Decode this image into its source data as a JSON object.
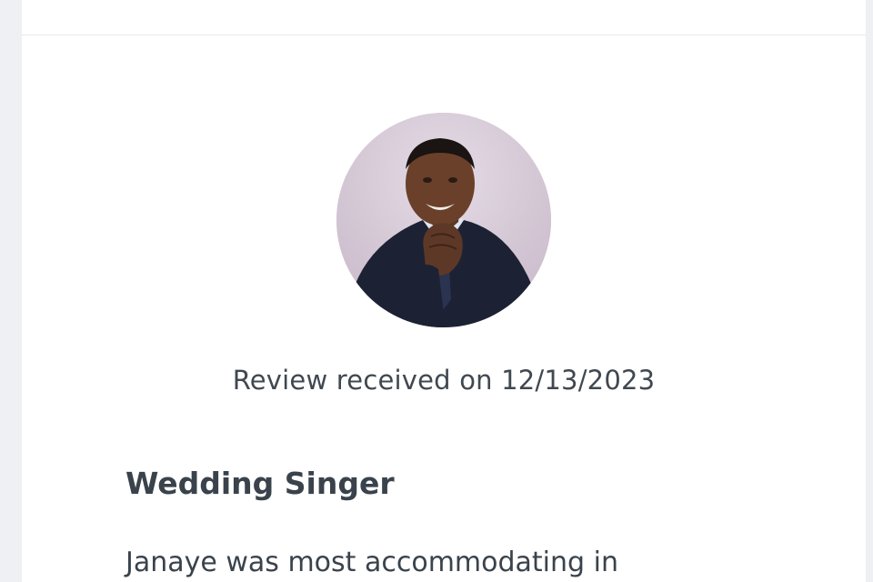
{
  "review": {
    "avatar_icon": "reviewer-photo",
    "received_text": "Review received on 12/13/2023",
    "title": "Wedding Singer",
    "body": "Janaye was most accommodating in"
  },
  "colors": {
    "page_background": "#eef0f4",
    "card_background": "#ffffff",
    "text_dark": "#3a434c"
  }
}
